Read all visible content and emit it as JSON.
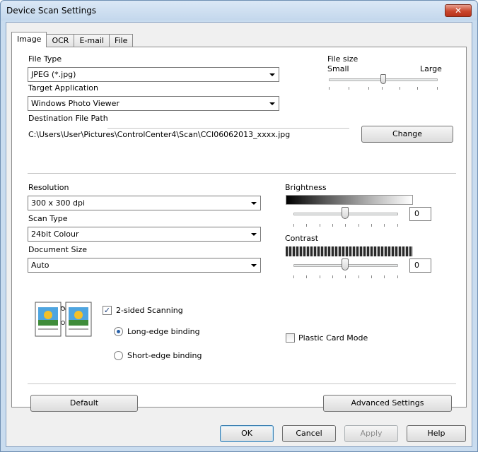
{
  "window": {
    "title": "Device Scan Settings"
  },
  "tabs": [
    "Image",
    "OCR",
    "E-mail",
    "File"
  ],
  "image_tab": {
    "file_type_label": "File Type",
    "file_type_value": "JPEG (*.jpg)",
    "file_size_label": "File size",
    "file_size_small": "Small",
    "file_size_large": "Large",
    "file_size_level": 0.5,
    "target_app_label": "Target Application",
    "target_app_value": "Windows Photo Viewer",
    "dest_path_label": "Destination File Path",
    "dest_path_value": "C:\\Users\\User\\Pictures\\ControlCenter4\\Scan\\CCI06062013_xxxx.jpg",
    "change_button": "Change",
    "resolution_label": "Resolution",
    "resolution_value": "300 x 300 dpi",
    "scan_type_label": "Scan Type",
    "scan_type_value": "24bit Colour",
    "doc_size_label": "Document Size",
    "doc_size_value": "Auto",
    "brightness_label": "Brightness",
    "brightness_value": "0",
    "contrast_label": "Contrast",
    "contrast_value": "0",
    "two_sided_label": "2-sided Scanning",
    "two_sided_checked": true,
    "long_edge_label": "Long-edge binding",
    "short_edge_label": "Short-edge binding",
    "plastic_card_label": "Plastic Card Mode",
    "plastic_card_checked": false,
    "default_button": "Default",
    "advanced_button": "Advanced Settings"
  },
  "footer": {
    "ok": "OK",
    "cancel": "Cancel",
    "apply": "Apply",
    "help": "Help"
  },
  "colors": {
    "title_bg": "#c3d7ec",
    "close_red": "#c9462c",
    "accent_blue": "#3c7fb1"
  }
}
